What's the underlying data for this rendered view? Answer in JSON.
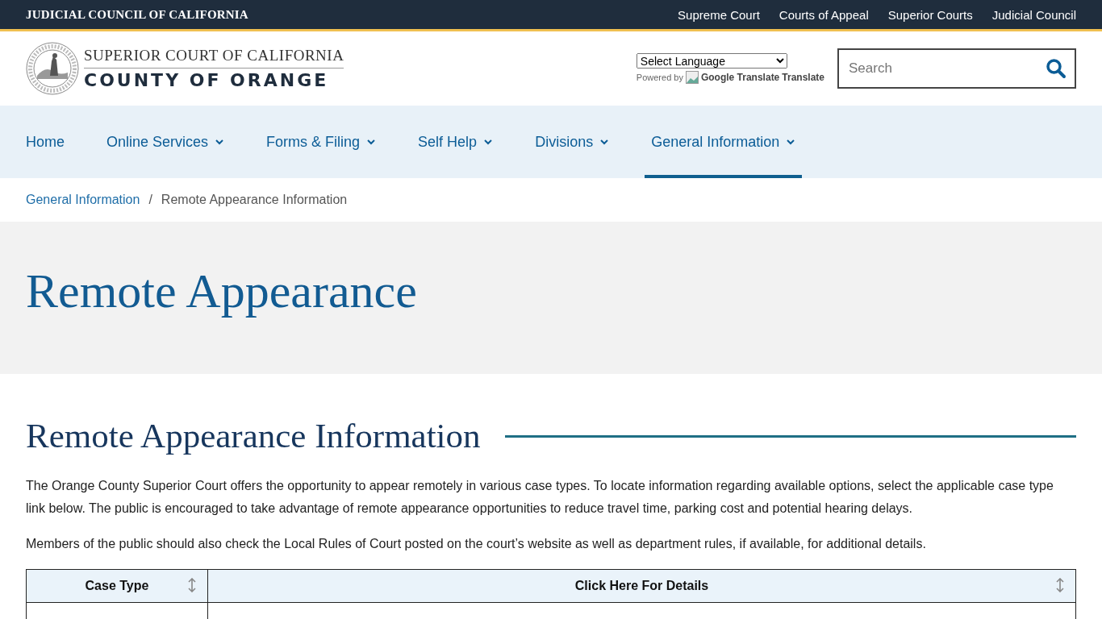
{
  "top_bar": {
    "title": "JUDICIAL COUNCIL OF CALIFORNIA",
    "links": [
      "Supreme Court",
      "Courts of Appeal",
      "Superior Courts",
      "Judicial Council"
    ]
  },
  "header": {
    "logo_line_1": "SUPERIOR COURT OF CALIFORNIA",
    "logo_line_2": "COUNTY OF ORANGE",
    "language_select": "Select Language",
    "powered_by": "Powered by",
    "translate_image_alt": "Google Translate",
    "translate_link": "Translate",
    "search": {
      "placeholder": "Search"
    }
  },
  "nav": [
    {
      "label": "Home",
      "dropdown": false,
      "selected": false
    },
    {
      "label": "Online Services",
      "dropdown": true,
      "selected": false
    },
    {
      "label": "Forms & Filing",
      "dropdown": true,
      "selected": false
    },
    {
      "label": "Self Help",
      "dropdown": true,
      "selected": false
    },
    {
      "label": "Divisions",
      "dropdown": true,
      "selected": false
    },
    {
      "label": "General Information",
      "dropdown": true,
      "selected": true
    }
  ],
  "breadcrumb": {
    "parent": "General Information",
    "separator": "/",
    "current": "Remote Appearance Information"
  },
  "page_title": "Remote Appearance",
  "section_title": "Remote Appearance Information",
  "paragraphs": [
    "The Orange County Superior Court offers the opportunity to appear remotely in various case types. To locate information regarding available options, select the applicable case type link below. The public is encouraged to take advantage of remote appearance opportunities to reduce travel time, parking cost and potential hearing delays.",
    "Members of the public should also check the Local Rules of Court posted on the court’s website as well as department rules, if available, for additional details."
  ],
  "table": {
    "columns": [
      "Case Type",
      "Click Here For Details"
    ]
  }
}
